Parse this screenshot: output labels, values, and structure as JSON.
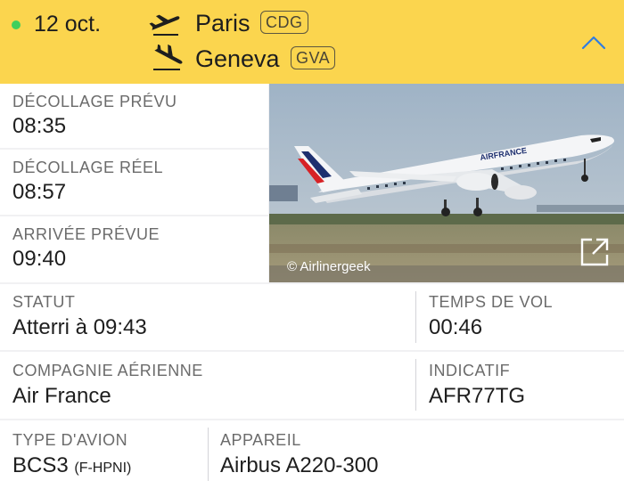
{
  "header": {
    "date": "12 oct.",
    "departure": {
      "city": "Paris",
      "code": "CDG"
    },
    "arrival": {
      "city": "Geneva",
      "code": "GVA"
    },
    "status_dot_color": "#3fcf5c",
    "background_color": "#fbd54e",
    "collapse_icon": "chevron-up-icon"
  },
  "times": {
    "scheduled_departure": {
      "label": "DÉCOLLAGE PRÉVU",
      "value": "08:35"
    },
    "actual_departure": {
      "label": "DÉCOLLAGE RÉEL",
      "value": "08:57"
    },
    "scheduled_arrival": {
      "label": "ARRIVÉE PRÉVUE",
      "value": "09:40"
    }
  },
  "photo": {
    "credit": "© Airlinergeek",
    "livery_text": "AIRFRANCE",
    "expand_icon": "external-link-icon"
  },
  "details": {
    "status": {
      "label": "STATUT",
      "value": "Atterri à 09:43"
    },
    "flight_time": {
      "label": "TEMPS DE VOL",
      "value": "00:46"
    },
    "airline": {
      "label": "COMPAGNIE AÉRIENNE",
      "value": "Air France"
    },
    "callsign": {
      "label": "INDICATIF",
      "value": "AFR77TG"
    },
    "aircraft_type": {
      "label": "TYPE D'AVION",
      "value": "BCS3",
      "registration": "(F-HPNI)"
    },
    "aircraft": {
      "label": "APPAREIL",
      "value": "Airbus A220-300"
    }
  }
}
